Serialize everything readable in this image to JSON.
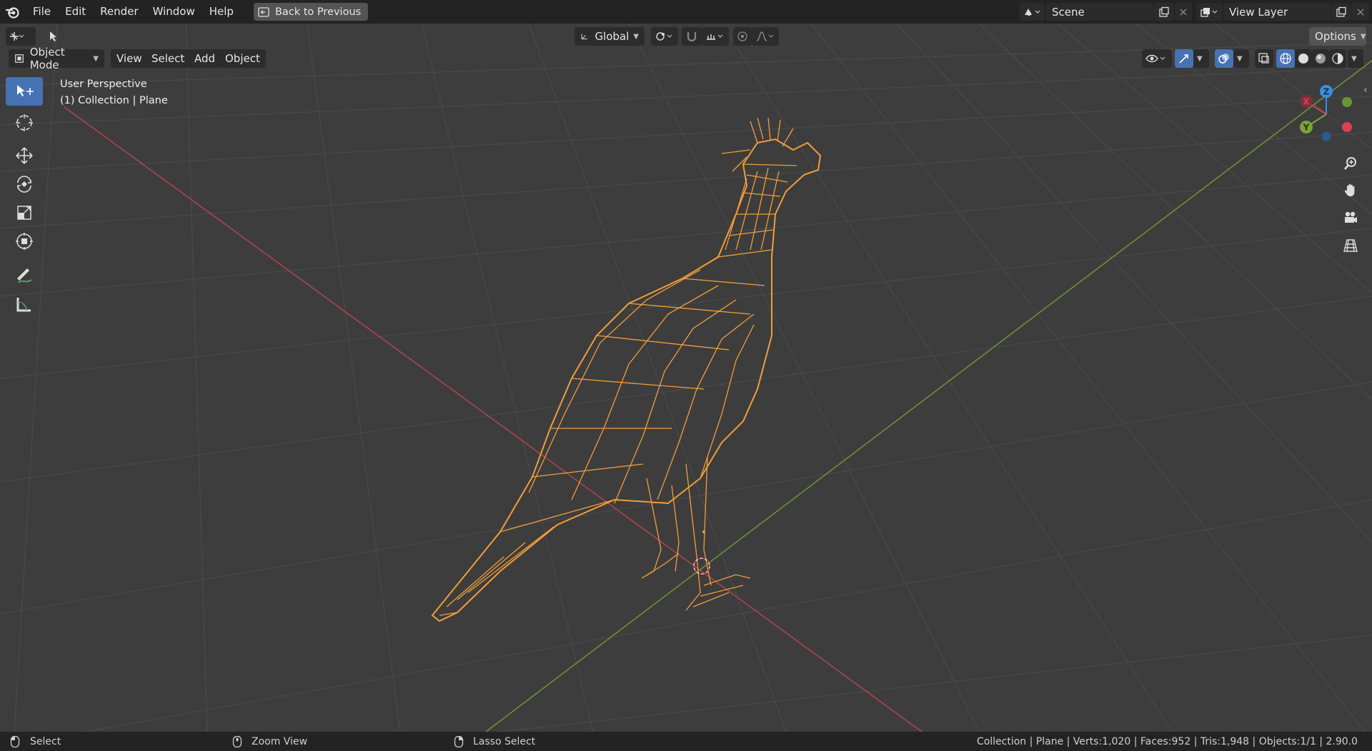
{
  "menu": {
    "items": [
      "File",
      "Edit",
      "Render",
      "Window",
      "Help"
    ],
    "back_button": "Back to Previous"
  },
  "scene": {
    "label": "Scene"
  },
  "view_layer": {
    "label": "View Layer"
  },
  "tool_header": {
    "orientation": "Global",
    "options": "Options"
  },
  "viewport_header": {
    "mode": "Object Mode",
    "menus": [
      "View",
      "Select",
      "Add",
      "Object"
    ]
  },
  "viewport": {
    "perspective_label": "User Perspective",
    "collection_label": "(1) Collection | Plane"
  },
  "gizmo": {
    "x": "X",
    "y": "Y",
    "z": "Z"
  },
  "statusbar": {
    "select": "Select",
    "zoom": "Zoom View",
    "lasso": "Lasso Select",
    "stats": "Collection | Plane | Verts:1,020 | Faces:952 | Tris:1,948 | Objects:1/1 | 2.90.0"
  },
  "colors": {
    "accent": "#4772b3",
    "selection": "#f29d3a",
    "x_axis": "#d9434f",
    "y_axis": "#7ba33a",
    "z_axis": "#3d8ee0"
  }
}
